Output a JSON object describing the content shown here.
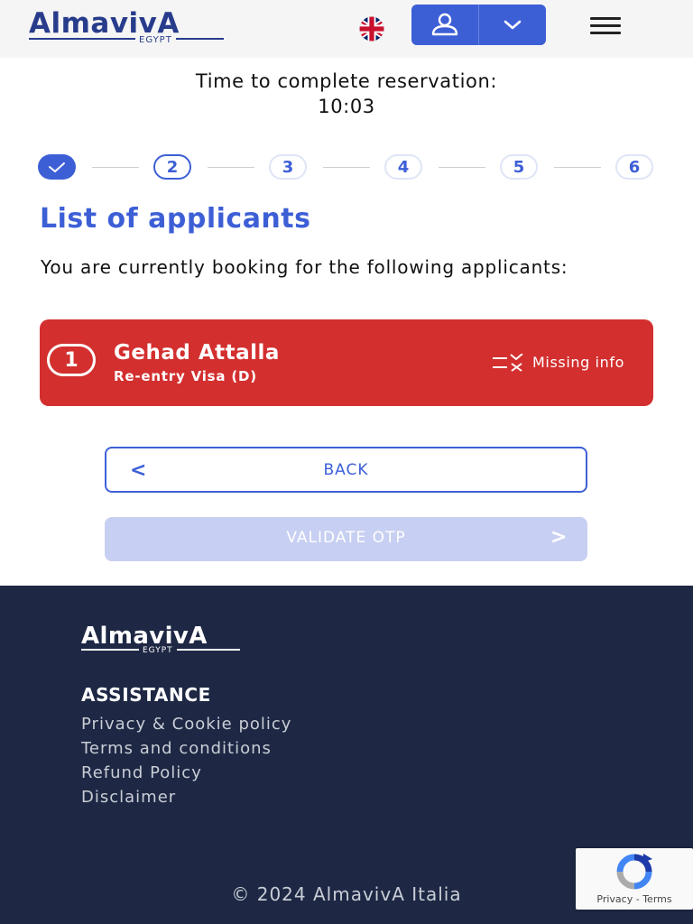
{
  "header": {
    "logo_text": "AlmavivA",
    "logo_sub": "EGYPT",
    "language_icon": "uk-flag-icon",
    "account_icon": "user-icon",
    "account_caret_icon": "chevron-down-icon",
    "menu_icon": "hamburger-icon"
  },
  "timer": {
    "label": "Time to complete reservation:",
    "value": "10:03"
  },
  "stepper": {
    "steps": [
      "2",
      "3",
      "4",
      "5",
      "6"
    ],
    "completed_icon": "check-icon"
  },
  "main": {
    "title": "List of applicants",
    "intro": "You are currently booking for the following applicants:"
  },
  "applicant": {
    "number": "1",
    "name": "Gehad Attalla",
    "visa_type": "Re-entry Visa (D)",
    "status_text": "Missing info",
    "status_icon": "missing-info-icon"
  },
  "buttons": {
    "back_label": "BACK",
    "back_icon": "<",
    "validate_label": "VALIDATE OTP",
    "validate_icon": ">"
  },
  "footer": {
    "logo_text": "AlmavivA",
    "logo_sub": "EGYPT",
    "heading": "ASSISTANCE",
    "links": [
      "Privacy & Cookie policy",
      "Terms and conditions",
      "Refund Policy",
      "Disclaimer"
    ],
    "copyright": "© 2024 AlmavivA Italia"
  },
  "recaptcha": {
    "text": "Privacy - Terms"
  },
  "colors": {
    "primary": "#3d5fd6",
    "danger": "#d32f2f",
    "footer_bg": "#1e2844",
    "disabled": "#c7cff2"
  }
}
